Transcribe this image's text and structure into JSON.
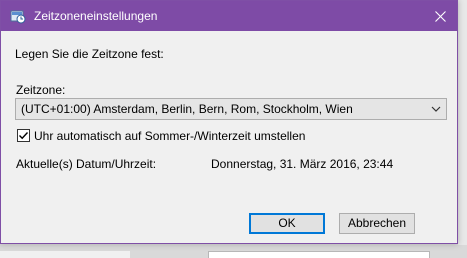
{
  "window": {
    "title": "Zeitzoneneinstellungen",
    "close_icon": "close-icon",
    "app_icon": "timezone-settings-icon",
    "accent_color": "#7e4ba6"
  },
  "form": {
    "prompt": "Legen Sie die Zeitzone fest:",
    "timezone_label": "Zeitzone:",
    "timezone_selected": "(UTC+01:00) Amsterdam, Berlin, Bern, Rom, Stockholm, Wien",
    "dst_checkbox_label": "Uhr automatisch auf Sommer-/Winterzeit umstellen",
    "dst_checked": true,
    "datetime_label": "Aktuelle(s) Datum/Uhrzeit:",
    "datetime_value": "Donnerstag, 31. März 2016, 23:44"
  },
  "buttons": {
    "ok": "OK",
    "cancel": "Abbrechen"
  }
}
